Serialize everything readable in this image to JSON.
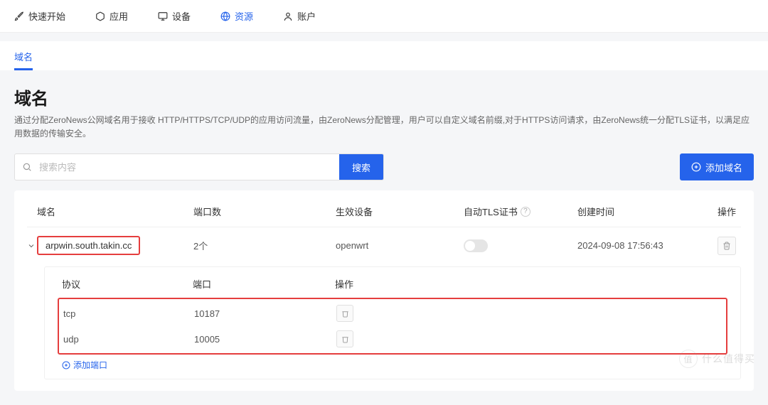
{
  "nav": {
    "items": [
      {
        "icon": "rocket-icon",
        "label": "快速开始"
      },
      {
        "icon": "cube-icon",
        "label": "应用"
      },
      {
        "icon": "monitor-icon",
        "label": "设备"
      },
      {
        "icon": "globe-icon",
        "label": "资源",
        "active": true
      },
      {
        "icon": "user-icon",
        "label": "账户"
      }
    ]
  },
  "tabs": [
    {
      "label": "域名",
      "active": true
    }
  ],
  "page": {
    "title": "域名",
    "description": "通过分配ZeroNews公网域名用于接收 HTTP/HTTPS/TCP/UDP的应用访问流量，由ZeroNews分配管理，用户可以自定义域名前缀,对于HTTPS访问请求，由ZeroNews统一分配TLS证书，以满足应用数据的传输安全。"
  },
  "search": {
    "placeholder": "搜索内容",
    "button": "搜索"
  },
  "actions": {
    "add_domain": "添加域名"
  },
  "table": {
    "headers": {
      "domain": "域名",
      "ports": "端口数",
      "device": "生效设备",
      "tls": "自动TLS证书",
      "created": "创建时间",
      "actions": "操作"
    },
    "rows": [
      {
        "domain": "arpwin.south.takin.cc",
        "port_count": "2个",
        "device": "openwrt",
        "tls_on": false,
        "created_at": "2024-09-08 17:56:43",
        "expanded": true,
        "ports": {
          "headers": {
            "protocol": "协议",
            "port": "端口",
            "actions": "操作"
          },
          "items": [
            {
              "protocol": "tcp",
              "port": "10187"
            },
            {
              "protocol": "udp",
              "port": "10005"
            }
          ],
          "add_port_label": "添加端口"
        }
      }
    ]
  },
  "watermark": "什么值得买"
}
